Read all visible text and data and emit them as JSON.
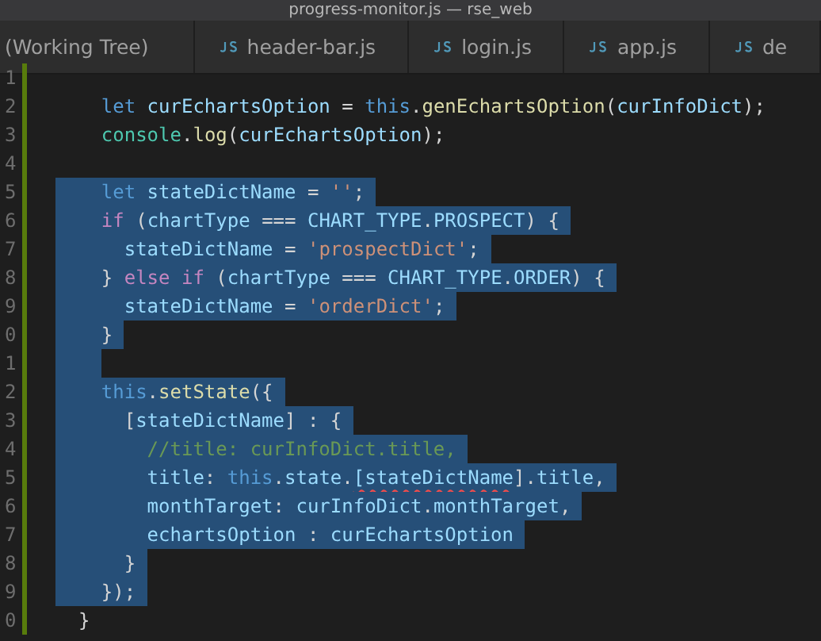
{
  "window": {
    "title": "progress-monitor.js — rse_web"
  },
  "tabs": [
    {
      "label": "(Working Tree)",
      "icon": false
    },
    {
      "label": "header-bar.js",
      "icon": true
    },
    {
      "label": "login.js",
      "icon": true
    },
    {
      "label": "app.js",
      "icon": true
    },
    {
      "label": "de",
      "icon": true
    }
  ],
  "editor": {
    "lines": [
      {
        "number": "1",
        "selected": false
      },
      {
        "number": "2",
        "selected": false,
        "tokens": [
          {
            "kind": "keyword",
            "text": "    let"
          },
          {
            "kind": "variable",
            "text": " curEchartsOption"
          },
          {
            "kind": "plain",
            "text": " = "
          },
          {
            "kind": "keyword",
            "text": "this"
          },
          {
            "kind": "plain",
            "text": "."
          },
          {
            "kind": "function",
            "text": "genEchartsOption"
          },
          {
            "kind": "plain",
            "text": "("
          },
          {
            "kind": "variable",
            "text": "curInfoDict"
          },
          {
            "kind": "plain",
            "text": ");"
          }
        ]
      },
      {
        "number": "3",
        "selected": false,
        "tokens": [
          {
            "kind": "type",
            "text": "    console"
          },
          {
            "kind": "plain",
            "text": "."
          },
          {
            "kind": "function",
            "text": "log"
          },
          {
            "kind": "plain",
            "text": "("
          },
          {
            "kind": "variable",
            "text": "curEchartsOption"
          },
          {
            "kind": "plain",
            "text": ");"
          }
        ]
      },
      {
        "number": "4",
        "selected": false
      },
      {
        "number": "5",
        "selected": true,
        "tokens": [
          {
            "kind": "keyword",
            "text": "    let"
          },
          {
            "kind": "variable",
            "text": " stateDictName"
          },
          {
            "kind": "plain",
            "text": " = "
          },
          {
            "kind": "string",
            "text": "''"
          },
          {
            "kind": "plain",
            "text": ";"
          }
        ]
      },
      {
        "number": "6",
        "selected": true,
        "tokens": [
          {
            "kind": "control",
            "text": "    if"
          },
          {
            "kind": "plain",
            "text": " ("
          },
          {
            "kind": "variable",
            "text": "chartType"
          },
          {
            "kind": "plain",
            "text": " === "
          },
          {
            "kind": "variable",
            "text": "CHART_TYPE"
          },
          {
            "kind": "plain",
            "text": "."
          },
          {
            "kind": "variable",
            "text": "PROSPECT"
          },
          {
            "kind": "plain",
            "text": ") {"
          }
        ]
      },
      {
        "number": "7",
        "selected": true,
        "tokens": [
          {
            "kind": "variable",
            "text": "      stateDictName"
          },
          {
            "kind": "plain",
            "text": " = "
          },
          {
            "kind": "string",
            "text": "'prospectDict'"
          },
          {
            "kind": "plain",
            "text": ";"
          }
        ]
      },
      {
        "number": "8",
        "selected": true,
        "tokens": [
          {
            "kind": "plain",
            "text": "    } "
          },
          {
            "kind": "control",
            "text": "else if"
          },
          {
            "kind": "plain",
            "text": " ("
          },
          {
            "kind": "variable",
            "text": "chartType"
          },
          {
            "kind": "plain",
            "text": " === "
          },
          {
            "kind": "variable",
            "text": "CHART_TYPE"
          },
          {
            "kind": "plain",
            "text": "."
          },
          {
            "kind": "variable",
            "text": "ORDER"
          },
          {
            "kind": "plain",
            "text": ") {"
          }
        ]
      },
      {
        "number": "9",
        "selected": true,
        "tokens": [
          {
            "kind": "variable",
            "text": "      stateDictName"
          },
          {
            "kind": "plain",
            "text": " = "
          },
          {
            "kind": "string",
            "text": "'orderDict'"
          },
          {
            "kind": "plain",
            "text": ";"
          }
        ]
      },
      {
        "number": "0",
        "selected": true,
        "tokens": [
          {
            "kind": "plain",
            "text": "    }"
          }
        ]
      },
      {
        "number": "1",
        "selected": true
      },
      {
        "number": "2",
        "selected": true,
        "tokens": [
          {
            "kind": "keyword",
            "text": "    this"
          },
          {
            "kind": "plain",
            "text": "."
          },
          {
            "kind": "function",
            "text": "setState"
          },
          {
            "kind": "plain",
            "text": "({"
          }
        ]
      },
      {
        "number": "3",
        "selected": true,
        "tokens": [
          {
            "kind": "plain",
            "text": "      ["
          },
          {
            "kind": "variable",
            "text": "stateDictName"
          },
          {
            "kind": "plain",
            "text": "] : {"
          }
        ]
      },
      {
        "number": "4",
        "selected": true,
        "tokens": [
          {
            "kind": "comment",
            "text": "        //title: curInfoDict.title,"
          }
        ]
      },
      {
        "number": "5",
        "selected": true,
        "tokens": [
          {
            "kind": "variable",
            "text": "        title"
          },
          {
            "kind": "plain",
            "text": ": "
          },
          {
            "kind": "keyword",
            "text": "this"
          },
          {
            "kind": "plain",
            "text": "."
          },
          {
            "kind": "variable",
            "text": "state"
          },
          {
            "kind": "plain",
            "text": "."
          },
          {
            "kind": "error",
            "text": "[stateDictName"
          },
          {
            "kind": "plain",
            "text": "]."
          },
          {
            "kind": "variable",
            "text": "title"
          },
          {
            "kind": "plain",
            "text": ","
          }
        ]
      },
      {
        "number": "6",
        "selected": true,
        "tokens": [
          {
            "kind": "variable",
            "text": "        monthTarget"
          },
          {
            "kind": "plain",
            "text": ": "
          },
          {
            "kind": "variable",
            "text": "curInfoDict"
          },
          {
            "kind": "plain",
            "text": "."
          },
          {
            "kind": "variable",
            "text": "monthTarget"
          },
          {
            "kind": "plain",
            "text": ","
          }
        ]
      },
      {
        "number": "7",
        "selected": true,
        "tokens": [
          {
            "kind": "variable",
            "text": "        echartsOption"
          },
          {
            "kind": "plain",
            "text": " : "
          },
          {
            "kind": "variable",
            "text": "curEchartsOption"
          }
        ]
      },
      {
        "number": "8",
        "selected": true,
        "tokens": [
          {
            "kind": "plain",
            "text": "      }"
          }
        ]
      },
      {
        "number": "9",
        "selected": true,
        "tokens": [
          {
            "kind": "plain",
            "text": "    });"
          }
        ]
      },
      {
        "number": "0",
        "selected": false,
        "tokens": [
          {
            "kind": "plain",
            "text": "  }"
          }
        ]
      }
    ]
  }
}
